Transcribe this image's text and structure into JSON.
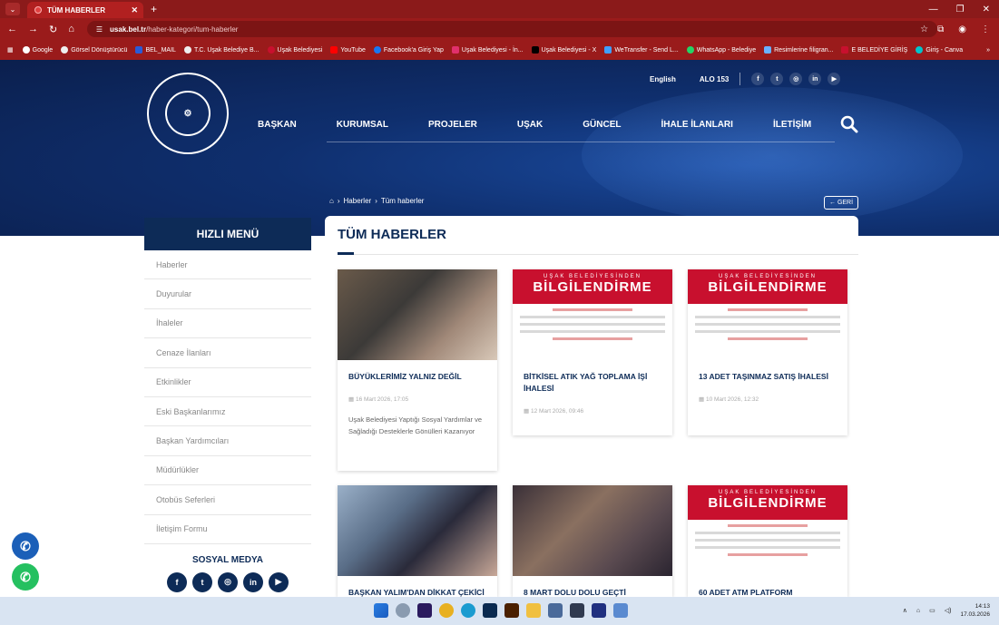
{
  "browser": {
    "tab_title": "TÜM HABERLER",
    "url_host": "usak.bel.tr",
    "url_path": "/haber-kategori/tum-haberler",
    "bookmarks": [
      "Google",
      "Görsel Dönüştürücü",
      "BEL_MAIL",
      "T.C. Uşak Belediye B...",
      "Uşak Belediyesi",
      "YouTube",
      "Facebook'a Giriş Yap",
      "Uşak Belediyesi - İn...",
      "Uşak Belediyesi - X",
      "WeTransfer - Send L...",
      "WhatsApp - Belediye",
      "Resimlerine filigran...",
      "E BELEDİYE GİRİŞ",
      "Giriş - Canva"
    ]
  },
  "header": {
    "lang": "English",
    "alo": "ALO 153",
    "social": [
      "f",
      "t",
      "◎",
      "in",
      "▶"
    ],
    "nav": [
      "BAŞKAN",
      "KURUMSAL",
      "PROJELER",
      "UŞAK",
      "GÜNCEL",
      "İHALE İLANLARI",
      "İLETİŞİM"
    ],
    "breadcrumb": [
      "Haberler",
      "Tüm haberler"
    ],
    "back": "GERİ"
  },
  "sidebar": {
    "title": "HIZLI MENÜ",
    "items": [
      "Haberler",
      "Duyurular",
      "İhaleler",
      "Cenaze İlanları",
      "Etkinlikler",
      "Eski Başkanlarımız",
      "Başkan Yardımcıları",
      "Müdürlükler",
      "Otobüs Seferleri",
      "İletişim Formu"
    ],
    "social_title": "SOSYAL MEDYA",
    "social": [
      "f",
      "t",
      "◎",
      "in",
      "▶"
    ]
  },
  "main": {
    "title": "TÜM HABERLER",
    "banner_small": "UŞAK BELEDİYESİNDEN",
    "banner_large": "BİLGİLENDİRME",
    "cards": [
      {
        "title": "BÜYÜKLERİMİZ YALNIZ DEĞİL",
        "date": "16 Mart 2026, 17:05",
        "desc": "Uşak Belediyesi Yaptığı Sosyal Yardımlar ve Sağladığı Desteklerle Gönülleri Kazanıyor"
      },
      {
        "title": "BİTKİSEL ATIK YAĞ TOPLAMA İŞİ İHALESİ",
        "date": "12 Mart 2026, 09:46",
        "desc": ""
      },
      {
        "title": "13 ADET TAŞINMAZ SATIŞ İHALESİ",
        "date": "10 Mart 2026, 12:32",
        "desc": ""
      },
      {
        "title": "BAŞKAN YALIM'DAN DİKKAT ÇEKİCİ",
        "date": "",
        "desc": ""
      },
      {
        "title": "8 MART DOLU DOLU GEÇTİ",
        "date": "",
        "desc": ""
      },
      {
        "title": "60 ADET ATM PLATFORM",
        "date": "",
        "desc": ""
      }
    ]
  },
  "taskbar": {
    "time": "14:13",
    "date": "17.03.2026"
  },
  "colors": {
    "brand": "#0d2b57",
    "chrome": "#9a1b1b",
    "banner_red": "#c8102e"
  }
}
